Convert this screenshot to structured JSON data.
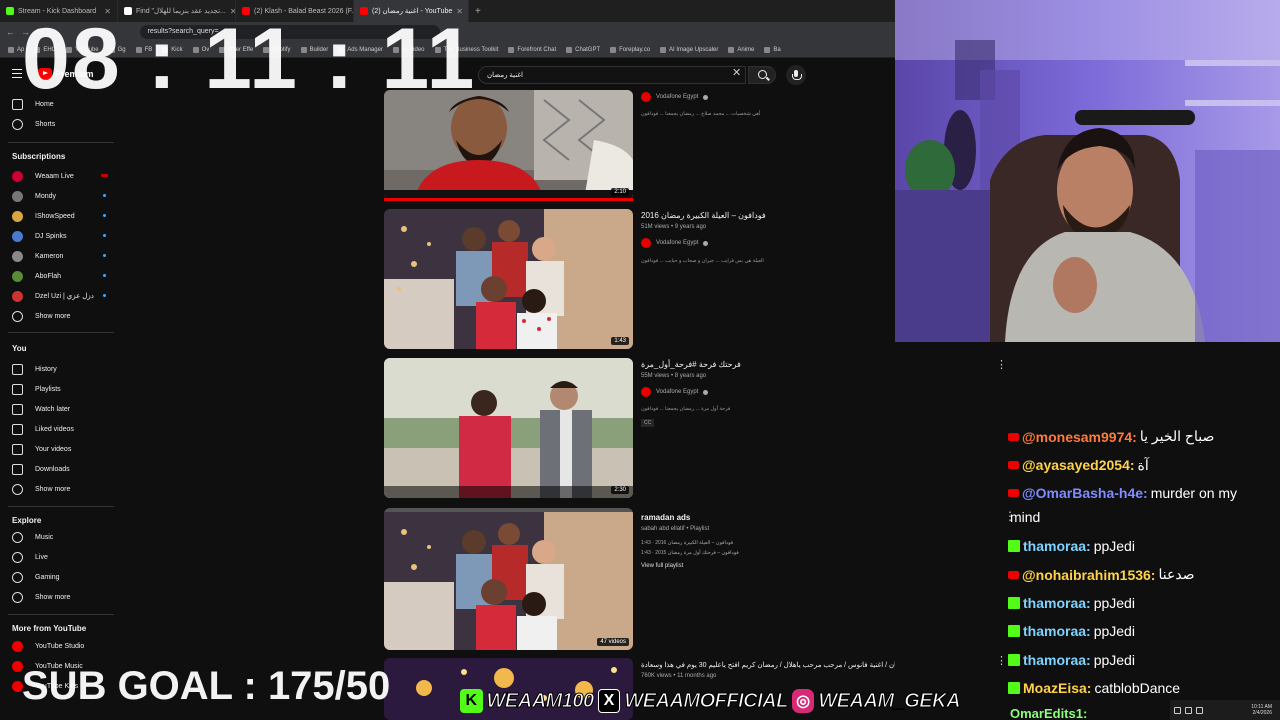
{
  "browser": {
    "tabs": [
      {
        "label": "Stream - Kick Dashboard",
        "color": "#53fc18"
      },
      {
        "label": "Find \"تجديد عقد بنزيما للهلال...",
        "color": "#fff"
      },
      {
        "label": "(2) Klash - Balad Beast 2026 (F...",
        "color": "#ff0000"
      },
      {
        "label": "(2) اغنية رمضان - YouTube",
        "color": "#ff0000",
        "active": true
      }
    ],
    "new_tab": "+",
    "url": "results?search_query=",
    "bookmarks": [
      "Ap",
      "EHC",
      "YouTube",
      "Gg",
      "FB",
      "Kick",
      "Ov",
      "After Effe",
      "Spotify",
      "Builder",
      "Ads Manager",
      "AI Video",
      "The Business Toolkit",
      "Forefront Chat",
      "ChatGPT",
      "Foreplay.co",
      "AI Image Upscaler",
      "Anime",
      "Ba"
    ]
  },
  "youtube": {
    "logo_text": "Premium",
    "search_value": "اغنية رمضان",
    "sidebar": {
      "main": [
        {
          "label": "Home",
          "icon": "home-icon"
        },
        {
          "label": "Shorts",
          "icon": "shorts-icon"
        }
      ],
      "subscriptions_header": "Subscriptions",
      "subscriptions": [
        {
          "label": "Weaam Live",
          "color": "#c03",
          "live": true
        },
        {
          "label": "Mondy",
          "color": "#777"
        },
        {
          "label": "IShowSpeed",
          "color": "#d9a441"
        },
        {
          "label": "DJ Spinks",
          "color": "#4a7bd0"
        },
        {
          "label": "Kameron",
          "color": "#888"
        },
        {
          "label": "AboFlah",
          "color": "#5a8a3a"
        },
        {
          "label": "Dzel Uzi | دزل عزي",
          "color": "#c33"
        }
      ],
      "show_more": "Show more",
      "you_header": "You",
      "you": [
        {
          "label": "History",
          "icon": "history-icon"
        },
        {
          "label": "Playlists",
          "icon": "playlists-icon"
        },
        {
          "label": "Watch later",
          "icon": "clock-icon"
        },
        {
          "label": "Liked videos",
          "icon": "thumb-up-icon"
        },
        {
          "label": "Your videos",
          "icon": "play-icon"
        },
        {
          "label": "Downloads",
          "icon": "download-icon"
        }
      ],
      "explore_header": "Explore",
      "explore": [
        {
          "label": "Music",
          "icon": "music-icon"
        },
        {
          "label": "Live",
          "icon": "live-icon"
        },
        {
          "label": "Gaming",
          "icon": "gaming-icon"
        }
      ],
      "more_header": "More from YouTube",
      "more": [
        {
          "label": "YouTube Studio"
        },
        {
          "label": "YouTube Music"
        },
        {
          "label": "YouTube Kids"
        }
      ]
    },
    "results": [
      {
        "title": "",
        "channel": "Vodafone Egypt",
        "meta": "",
        "desc": "أهي شخصيات ... محمد صلاح ... رمضان يجمعنا ... فودافون",
        "duration": "2:10"
      },
      {
        "title": "فودافون – العيلة الكبيرة رمضان 2016",
        "channel": "Vodafone Egypt",
        "meta": "51M views • 9 years ago",
        "desc": "العيلة هي بس فرايب ... جيران و صحاب و حبايب ... فودافون",
        "duration": "1:43"
      },
      {
        "title": "فرحتك فرحة #فرحة_أول_مرة",
        "channel": "Vodafone Egypt",
        "meta": "55M views • 8 years ago",
        "desc": "فرحة أول مرة ... رمضان يجمعنا ... فودافون",
        "duration": "2:30",
        "cc": "CC"
      },
      {
        "title": "ramadan ads",
        "channel": "sabah abd ellatif • Playlist",
        "meta": "",
        "playlist_items": [
          "فودافون – العيلة الكبيرة رمضان 2016 · 1:43",
          "فودافون – فرحتك أول مرة رمضان 2015 · 1:43"
        ],
        "playlist_link": "View full playlist",
        "duration": "47 videos"
      },
      {
        "title": "اغاني رمضان / اغنية فانوس / مرحب مرحب ياهلال / رمضان كريم افتح ياعليم 30 يوم في هذا وسعادة",
        "channel": "",
        "meta": "760K views • 11 months ago",
        "desc": "",
        "duration": ""
      }
    ]
  },
  "overlay": {
    "timer": "08 : 11 : 11",
    "sub_goal": "SUB GOAL : 175/50",
    "socials": [
      {
        "icon": "kick-icon",
        "label": "WEAAM100"
      },
      {
        "icon": "x-icon",
        "label": "WEAAMOFFICIAL"
      },
      {
        "icon": "instagram-icon",
        "label": "WEAAM_GEKA"
      }
    ]
  },
  "chat": {
    "messages": [
      {
        "platform": "youtube",
        "user": "@monesam9974:",
        "text": "صباح الخير يا",
        "color": "#ff7a3d"
      },
      {
        "platform": "youtube",
        "user": "@ayasayed2054:",
        "text": "آة",
        "color": "#ffd24a"
      },
      {
        "platform": "youtube",
        "user": "@OmarBasha-h4e:",
        "text": "murder on my",
        "text2": "mind",
        "color": "#7f8cff"
      },
      {
        "platform": "kick",
        "user": "thamoraa:",
        "text": "ppJedi",
        "color": "#7fd3ff"
      },
      {
        "platform": "youtube",
        "user": "@nohaibrahim1536:",
        "text": "صدعنا",
        "color": "#ffd24a"
      },
      {
        "platform": "kick",
        "user": "thamoraa:",
        "text": "ppJedi",
        "color": "#7fd3ff"
      },
      {
        "platform": "kick",
        "user": "thamoraa:",
        "text": "ppJedi",
        "color": "#7fd3ff"
      },
      {
        "platform": "kick",
        "user": "thamoraa:",
        "text": "ppJedi",
        "color": "#7fd3ff"
      },
      {
        "platform": "kick",
        "user": "MoazEisa:",
        "text": "catblobDance",
        "color": "#ffd24a"
      }
    ],
    "partial": "OmarEdits1:"
  },
  "taskbar": {
    "time": "10:11 AM",
    "date": "2/4/2026"
  }
}
